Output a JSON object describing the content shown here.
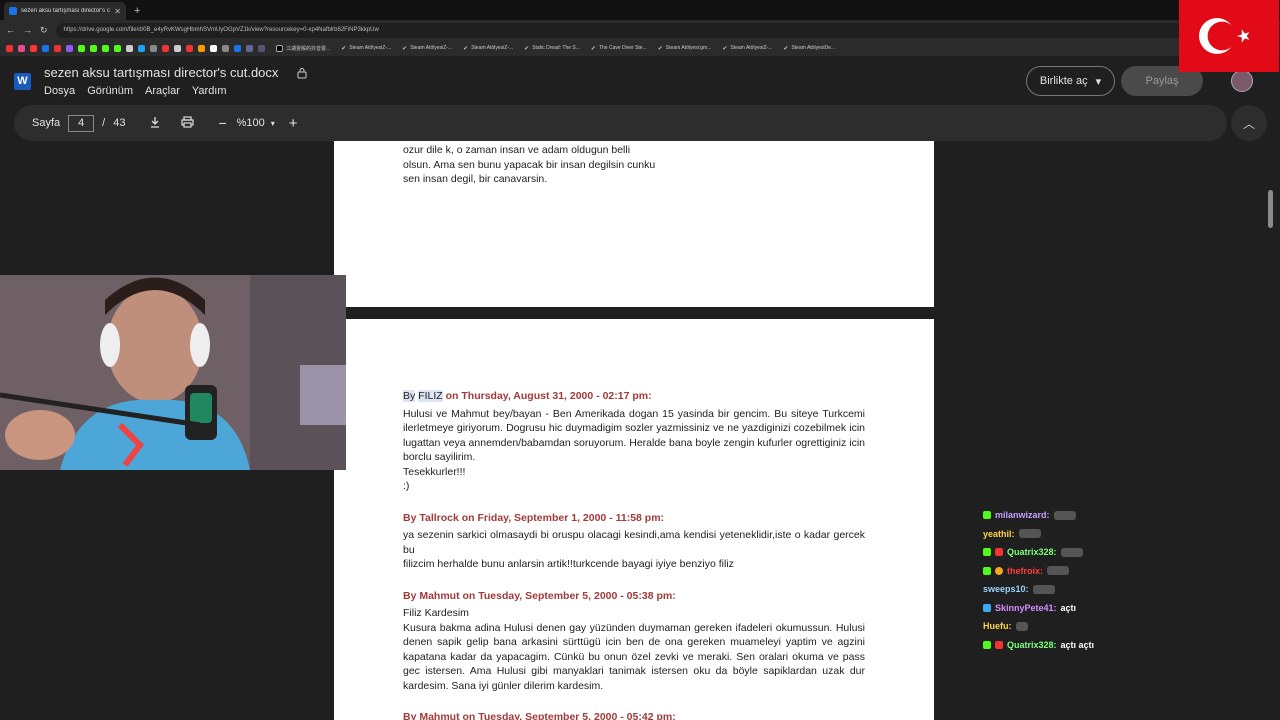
{
  "browser": {
    "tab_title": "sezen aksu tartışması director's cut.docx",
    "url": "https://drive.google.com/file/d/0B_e4yRvKWsgHbmhSVmUyOGpVZ1k/view?resourcekey=0-xp4Nafblrb62FiNP3kkpUw",
    "bookmarks": [
      "江湖霊殿的抖音霊...",
      "Steam AtölyesiZ-...",
      "Steam AtölyesiZ-...",
      "Steam AtölyesiZ-...",
      "Static Dread: The S...",
      "The Cave Diver Ste...",
      "Steam Atölyesi:gm...",
      "Steam AtölyesiZ-...",
      "Steam AtölyesiDe..."
    ]
  },
  "doc": {
    "title": "sezen aksu tartışması director's cut.docx",
    "app_icon": "W",
    "menu": [
      "Dosya",
      "Görünüm",
      "Araçlar",
      "Yardım"
    ],
    "open_with": "Birlikte aç",
    "share": "Paylaş"
  },
  "toolbar": {
    "page_label": "Sayfa",
    "page_current": "4",
    "page_sep": "/",
    "page_total": "43",
    "zoom": "%100"
  },
  "page1": {
    "lines": [
      "ozur dile k, o zaman insan ve adam oldugun belli",
      "olsun. Ama sen bunu yapacak bir insan degilsin cunku",
      "sen insan degil, bir canavarsin."
    ]
  },
  "page2": {
    "post1": {
      "author_by": "By",
      "author_name": "FILIZ",
      "author_rest": " on Thursday, August 31, 2000 - 02:17 pm:",
      "body": "Hulusi ve Mahmut bey/bayan - Ben Amerikada dogan 15 yasinda bir gencim. Bu siteye Turkcemi ilerletmeye giriyorum. Dogrusu hic duymadigim sozler yazmissiniz ve ne yazdiginizi cozebilmek icin lugattan veya annemden/babamdan soruyorum. Heralde bana boyle zengin kufurler ogrettiginiz icin borclu sayilirim.",
      "line2": "Tesekkurler!!!",
      "line3": ":)"
    },
    "post2": {
      "header": "By Tallrock on Friday, September 1, 2000 - 11:58 pm:",
      "body": "ya sezenin sarkici olmasaydi bi oruspu olacagi kesindi,ama kendisi yeteneklidir,iste o kadar gercek bu",
      "line2": "filizcim herhalde bunu anlarsin artik!!turkcende bayagi iyiye benziyo filiz"
    },
    "post3": {
      "header": "By Mahmut on Tuesday, September 5, 2000 - 05:38 pm:",
      "line1": "Filiz Kardesim",
      "body": "Kusura bakma adina Hulusi denen gay yüzünden duymaman gereken ifadeleri okumussun. Hulusi denen sapik gelip bana arkasini sürttügü icin ben de ona gereken muameleyi yaptim ve agzini kapatana kadar da yapacagim. Cünkü bu onun özel zevki ve meraki. Sen oralari okuma ve pass gec istersen. Ama Hulusi gibi manyaklari tanimak istersen oku da böyle sapiklardan uzak dur kardesim. Sana iyi günler dilerim kardesim."
    },
    "post4": {
      "header": "By Mahmut on Tuesday, September 5, 2000 - 05:42 pm:"
    }
  },
  "chat": [
    {
      "user": "milanwizard:",
      "color": "#c7a0ff",
      "msg": ""
    },
    {
      "user": "yeathil:",
      "color": "#ffd34d",
      "msg": ""
    },
    {
      "user": "Quatrix328:",
      "color": "#7dff7d",
      "msg": ""
    },
    {
      "user": "thefroix:",
      "color": "#ff3b3b",
      "msg": ""
    },
    {
      "user": "sweeps10:",
      "color": "#9ad3ff",
      "msg": ""
    },
    {
      "user": "SkinnyPete41:",
      "color": "#d58cff",
      "msg": "açtı"
    },
    {
      "user": "Huefu:",
      "color": "#ffd34d",
      "msg": ""
    },
    {
      "user": "Quatrix328:",
      "color": "#7dff7d",
      "msg": "açtı açtı"
    }
  ]
}
